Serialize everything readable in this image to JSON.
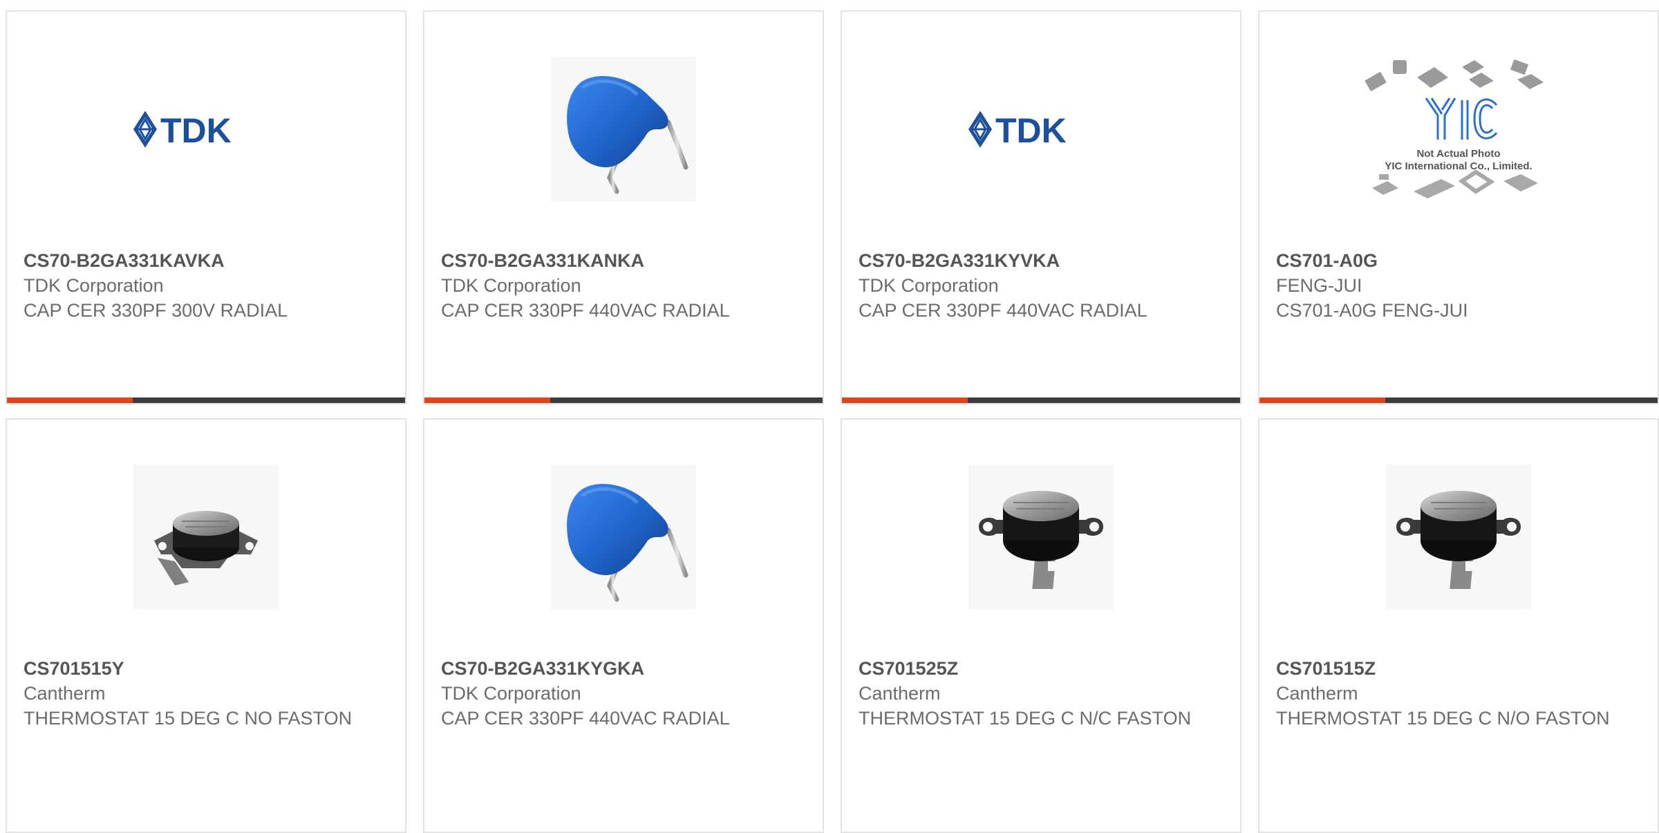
{
  "colors": {
    "accent": "#e4431a",
    "bar": "#3d3d3d",
    "tdk_blue": "#1c4f9c",
    "capacitor_blue": "#1f63c9"
  },
  "products": [
    {
      "part_number": "CS70-B2GA331KAVKA",
      "manufacturer": "TDK Corporation",
      "description": "CAP CER 330PF 300V RADIAL",
      "image": "tdk-logo"
    },
    {
      "part_number": "CS70-B2GA331KANKA",
      "manufacturer": "TDK Corporation",
      "description": "CAP CER 330PF 440VAC RADIAL",
      "image": "blue-disc-capacitor"
    },
    {
      "part_number": "CS70-B2GA331KYVKA",
      "manufacturer": "TDK Corporation",
      "description": "CAP CER 330PF 440VAC RADIAL",
      "image": "tdk-logo"
    },
    {
      "part_number": "CS701-A0G",
      "manufacturer": "FENG-JUI",
      "description": "CS701-A0G FENG-JUI",
      "image": "yic-placeholder",
      "placeholder_line1": "Not Actual Photo",
      "placeholder_line2": "YIC International Co., Limited.",
      "placeholder_logo": "YIC"
    },
    {
      "part_number": "CS701515Y",
      "manufacturer": "Cantherm",
      "description": "THERMOSTAT 15 DEG C NO FASTON",
      "image": "thermostat-flat"
    },
    {
      "part_number": "CS70-B2GA331KYGKA",
      "manufacturer": "TDK Corporation",
      "description": "CAP CER 330PF 440VAC RADIAL",
      "image": "blue-disc-capacitor"
    },
    {
      "part_number": "CS701525Z",
      "manufacturer": "Cantherm",
      "description": "THERMOSTAT 15 DEG C N/C FASTON",
      "image": "thermostat-tab"
    },
    {
      "part_number": "CS701515Z",
      "manufacturer": "Cantherm",
      "description": "THERMOSTAT 15 DEG C N/O FASTON",
      "image": "thermostat-tab"
    }
  ],
  "logos": {
    "tdk": "TDK"
  }
}
